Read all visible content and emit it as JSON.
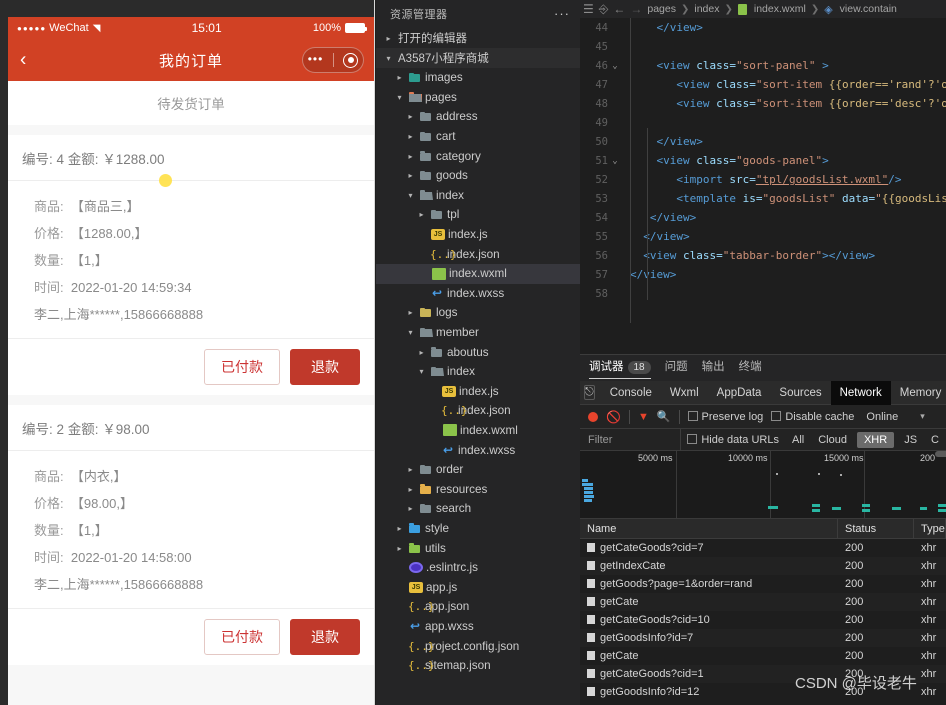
{
  "simulator": {
    "statusbar": {
      "carrier": "WeChat",
      "signal_dots": "●●●●●",
      "wifi": "◥",
      "time": "15:01",
      "battery_pct": "100%"
    },
    "navbar": {
      "back_icon": "‹",
      "title": "我的订单",
      "capsule_dots": "•••"
    },
    "page_title": "待发货订单",
    "orders": [
      {
        "head": "编号: 4 金额: ￥1288.00",
        "lines": [
          {
            "label": "商品:",
            "value": "【商品三,】"
          },
          {
            "label": "价格:",
            "value": "【1288.00,】"
          },
          {
            "label": "数量:",
            "value": "【1,】"
          },
          {
            "label": "时间:",
            "value": "2022-01-20 14:59:34"
          }
        ],
        "address": "李二,上海******,15866668888",
        "btn_paid": "已付款",
        "btn_refund": "退款"
      },
      {
        "head": "编号: 2 金额: ￥98.00",
        "lines": [
          {
            "label": "商品:",
            "value": "【内衣,】"
          },
          {
            "label": "价格:",
            "value": "【98.00,】"
          },
          {
            "label": "数量:",
            "value": "【1,】"
          },
          {
            "label": "时间:",
            "value": "2022-01-20 14:58:00"
          }
        ],
        "address": "李二,上海******,15866668888",
        "btn_paid": "已付款",
        "btn_refund": "退款"
      }
    ]
  },
  "explorer": {
    "header": "资源管理器",
    "more_icon": "···",
    "sections": [
      {
        "label": "打开的编辑器",
        "arrow": "▸"
      },
      {
        "label": "A3587小程序商城",
        "arrow": "▾"
      }
    ],
    "tree": [
      {
        "indent": 1,
        "arrow": "▸",
        "icon": "folder-images",
        "label": "images",
        "selected": false
      },
      {
        "indent": 1,
        "arrow": "▾",
        "icon": "folder-open-pages",
        "label": "pages",
        "selected": false
      },
      {
        "indent": 2,
        "arrow": "▸",
        "icon": "folder",
        "label": "address",
        "selected": false
      },
      {
        "indent": 2,
        "arrow": "▸",
        "icon": "folder",
        "label": "cart",
        "selected": false
      },
      {
        "indent": 2,
        "arrow": "▸",
        "icon": "folder",
        "label": "category",
        "selected": false
      },
      {
        "indent": 2,
        "arrow": "▸",
        "icon": "folder",
        "label": "goods",
        "selected": false
      },
      {
        "indent": 2,
        "arrow": "▾",
        "icon": "folder-open",
        "label": "index",
        "selected": false
      },
      {
        "indent": 3,
        "arrow": "▸",
        "icon": "folder",
        "label": "tpl",
        "selected": false
      },
      {
        "indent": 3,
        "arrow": "",
        "icon": "js",
        "label": "index.js",
        "selected": false
      },
      {
        "indent": 3,
        "arrow": "",
        "icon": "json",
        "label": "index.json",
        "selected": false
      },
      {
        "indent": 3,
        "arrow": "",
        "icon": "wxml",
        "label": "index.wxml",
        "selected": true
      },
      {
        "indent": 3,
        "arrow": "",
        "icon": "wxss",
        "label": "index.wxss",
        "selected": false
      },
      {
        "indent": 2,
        "arrow": "▸",
        "icon": "folder-logs",
        "label": "logs",
        "selected": false
      },
      {
        "indent": 2,
        "arrow": "▾",
        "icon": "folder-open",
        "label": "member",
        "selected": false
      },
      {
        "indent": 3,
        "arrow": "▸",
        "icon": "folder",
        "label": "aboutus",
        "selected": false
      },
      {
        "indent": 3,
        "arrow": "▾",
        "icon": "folder-open",
        "label": "index",
        "selected": false
      },
      {
        "indent": 4,
        "arrow": "",
        "icon": "js",
        "label": "index.js",
        "selected": false
      },
      {
        "indent": 4,
        "arrow": "",
        "icon": "json",
        "label": "index.json",
        "selected": false
      },
      {
        "indent": 4,
        "arrow": "",
        "icon": "wxml",
        "label": "index.wxml",
        "selected": false
      },
      {
        "indent": 4,
        "arrow": "",
        "icon": "wxss",
        "label": "index.wxss",
        "selected": false
      },
      {
        "indent": 2,
        "arrow": "▸",
        "icon": "folder",
        "label": "order",
        "selected": false
      },
      {
        "indent": 2,
        "arrow": "▸",
        "icon": "folder-res",
        "label": "resources",
        "selected": false
      },
      {
        "indent": 2,
        "arrow": "▸",
        "icon": "folder",
        "label": "search",
        "selected": false
      },
      {
        "indent": 1,
        "arrow": "▸",
        "icon": "folder-style",
        "label": "style",
        "selected": false
      },
      {
        "indent": 1,
        "arrow": "▸",
        "icon": "folder-utils",
        "label": "utils",
        "selected": false
      },
      {
        "indent": 1,
        "arrow": "",
        "icon": "eslint",
        "label": ".eslintrc.js",
        "selected": false
      },
      {
        "indent": 1,
        "arrow": "",
        "icon": "js",
        "label": "app.js",
        "selected": false
      },
      {
        "indent": 1,
        "arrow": "",
        "icon": "json",
        "label": "app.json",
        "selected": false
      },
      {
        "indent": 1,
        "arrow": "",
        "icon": "wxss",
        "label": "app.wxss",
        "selected": false
      },
      {
        "indent": 1,
        "arrow": "",
        "icon": "json",
        "label": "project.config.json",
        "selected": false
      },
      {
        "indent": 1,
        "arrow": "",
        "icon": "json",
        "label": "sitemap.json",
        "selected": false
      }
    ]
  },
  "editor": {
    "toolbar_icons": [
      "menu-icon",
      "bookmark-icon",
      "back-arrow-icon",
      "forward-arrow-icon"
    ],
    "breadcrumb": [
      "pages",
      "index",
      "index.wxml",
      "view.contain"
    ],
    "lines": [
      {
        "num": "44",
        "fold": "",
        "segments": [
          {
            "t": "    ",
            "c": ""
          },
          {
            "t": "</view>",
            "c": "t-tag"
          }
        ]
      },
      {
        "num": "45",
        "fold": "",
        "segments": []
      },
      {
        "num": "46",
        "fold": "⌄",
        "segments": [
          {
            "t": "    ",
            "c": ""
          },
          {
            "t": "<view ",
            "c": "t-tag"
          },
          {
            "t": "class=",
            "c": "t-attr"
          },
          {
            "t": "\"sort-panel\"",
            "c": "t-str"
          },
          {
            "t": " >",
            "c": "t-tag"
          }
        ]
      },
      {
        "num": "47",
        "fold": "",
        "segments": [
          {
            "t": "       ",
            "c": ""
          },
          {
            "t": "<view ",
            "c": "t-tag"
          },
          {
            "t": "class=",
            "c": "t-attr"
          },
          {
            "t": "\"sort-item ",
            "c": "t-str"
          },
          {
            "t": "{{order=='rand'?'on':'",
            "c": "t-mus"
          }
        ]
      },
      {
        "num": "48",
        "fold": "",
        "segments": [
          {
            "t": "       ",
            "c": ""
          },
          {
            "t": "<view ",
            "c": "t-tag"
          },
          {
            "t": "class=",
            "c": "t-attr"
          },
          {
            "t": "\"sort-item ",
            "c": "t-str"
          },
          {
            "t": "{{order=='desc'?'on':'",
            "c": "t-mus"
          }
        ]
      },
      {
        "num": "49",
        "fold": "",
        "segments": []
      },
      {
        "num": "50",
        "fold": "",
        "segments": [
          {
            "t": "    ",
            "c": ""
          },
          {
            "t": "</view>",
            "c": "t-tag"
          }
        ]
      },
      {
        "num": "51",
        "fold": "⌄",
        "segments": [
          {
            "t": "    ",
            "c": ""
          },
          {
            "t": "<view ",
            "c": "t-tag"
          },
          {
            "t": "class=",
            "c": "t-attr"
          },
          {
            "t": "\"goods-panel\"",
            "c": "t-str"
          },
          {
            "t": ">",
            "c": "t-tag"
          }
        ]
      },
      {
        "num": "52",
        "fold": "",
        "segments": [
          {
            "t": "       ",
            "c": ""
          },
          {
            "t": "<import ",
            "c": "t-tag"
          },
          {
            "t": "src=",
            "c": "t-attr"
          },
          {
            "t": "\"tpl/goodsList.wxml\"",
            "c": "t-link"
          },
          {
            "t": "/>",
            "c": "t-tag"
          }
        ]
      },
      {
        "num": "53",
        "fold": "",
        "segments": [
          {
            "t": "       ",
            "c": ""
          },
          {
            "t": "<template ",
            "c": "t-tag"
          },
          {
            "t": "is=",
            "c": "t-attr"
          },
          {
            "t": "\"goodsList\"",
            "c": "t-str"
          },
          {
            "t": " data=",
            "c": "t-attr"
          },
          {
            "t": "\"",
            "c": "t-str"
          },
          {
            "t": "{{goodsList:go",
            "c": "t-mus"
          }
        ]
      },
      {
        "num": "54",
        "fold": "",
        "segments": [
          {
            "t": "   ",
            "c": ""
          },
          {
            "t": "</view>",
            "c": "t-tag"
          }
        ]
      },
      {
        "num": "55",
        "fold": "",
        "segments": [
          {
            "t": "  ",
            "c": ""
          },
          {
            "t": "</view>",
            "c": "t-tag"
          }
        ]
      },
      {
        "num": "56",
        "fold": "",
        "segments": [
          {
            "t": "  ",
            "c": ""
          },
          {
            "t": "<view ",
            "c": "t-tag"
          },
          {
            "t": "class=",
            "c": "t-attr"
          },
          {
            "t": "\"tabbar-border\"",
            "c": "t-str"
          },
          {
            "t": "></view>",
            "c": "t-tag"
          }
        ]
      },
      {
        "num": "57",
        "fold": "",
        "segments": [
          {
            "t": "",
            "c": ""
          },
          {
            "t": "</view>",
            "c": "t-tag"
          }
        ]
      },
      {
        "num": "58",
        "fold": "",
        "segments": []
      }
    ]
  },
  "devtools": {
    "panel_tabs": [
      {
        "label": "调试器",
        "badge": "18",
        "active": true
      },
      {
        "label": "问题",
        "badge": "",
        "active": false
      },
      {
        "label": "输出",
        "badge": "",
        "active": false
      },
      {
        "label": "终端",
        "badge": "",
        "active": false
      }
    ],
    "inspector_icon": "cursor-select-icon",
    "sub_tabs": [
      {
        "label": "Console",
        "active": false
      },
      {
        "label": "Wxml",
        "active": false
      },
      {
        "label": "AppData",
        "active": false
      },
      {
        "label": "Sources",
        "active": false
      },
      {
        "label": "Network",
        "active": true
      },
      {
        "label": "Memory",
        "active": false
      }
    ],
    "network_toolbar": {
      "record_label": "record-icon",
      "clear_label": "clear-icon",
      "filter_label": "filter-icon",
      "search_label": "search-icon",
      "preserve_log": "Preserve log",
      "disable_cache": "Disable cache",
      "throttling": "Online",
      "caret": "▾"
    },
    "filter_row": {
      "placeholder": "Filter",
      "hide_data_urls": "Hide data URLs",
      "types": [
        {
          "label": "All",
          "on": false
        },
        {
          "label": "Cloud",
          "on": false
        },
        {
          "label": "XHR",
          "on": true
        },
        {
          "label": "JS",
          "on": false
        },
        {
          "label": "C",
          "on": false
        }
      ]
    },
    "waterfall": {
      "ticks": [
        "5000 ms",
        "10000 ms",
        "15000 ms",
        "200"
      ]
    },
    "table": {
      "columns": [
        "Name",
        "Status",
        "Type"
      ],
      "rows": [
        {
          "name": "getCateGoods?cid=7",
          "status": "200",
          "type": "xhr"
        },
        {
          "name": "getIndexCate",
          "status": "200",
          "type": "xhr"
        },
        {
          "name": "getGoods?page=1&order=rand",
          "status": "200",
          "type": "xhr"
        },
        {
          "name": "getCate",
          "status": "200",
          "type": "xhr"
        },
        {
          "name": "getCateGoods?cid=10",
          "status": "200",
          "type": "xhr"
        },
        {
          "name": "getGoodsInfo?id=7",
          "status": "200",
          "type": "xhr"
        },
        {
          "name": "getCate",
          "status": "200",
          "type": "xhr"
        },
        {
          "name": "getCateGoods?cid=1",
          "status": "200",
          "type": "xhr"
        },
        {
          "name": "getGoodsInfo?id=12",
          "status": "200",
          "type": "xhr"
        }
      ]
    }
  },
  "watermark": "CSDN @毕设老牛",
  "colors": {
    "brand_red": "#d14124",
    "refund_red": "#c0392b",
    "editor_bg": "#1e1e1e",
    "explorer_bg": "#252526",
    "selection": "#37373d",
    "accent_green": "#29b6a2"
  }
}
